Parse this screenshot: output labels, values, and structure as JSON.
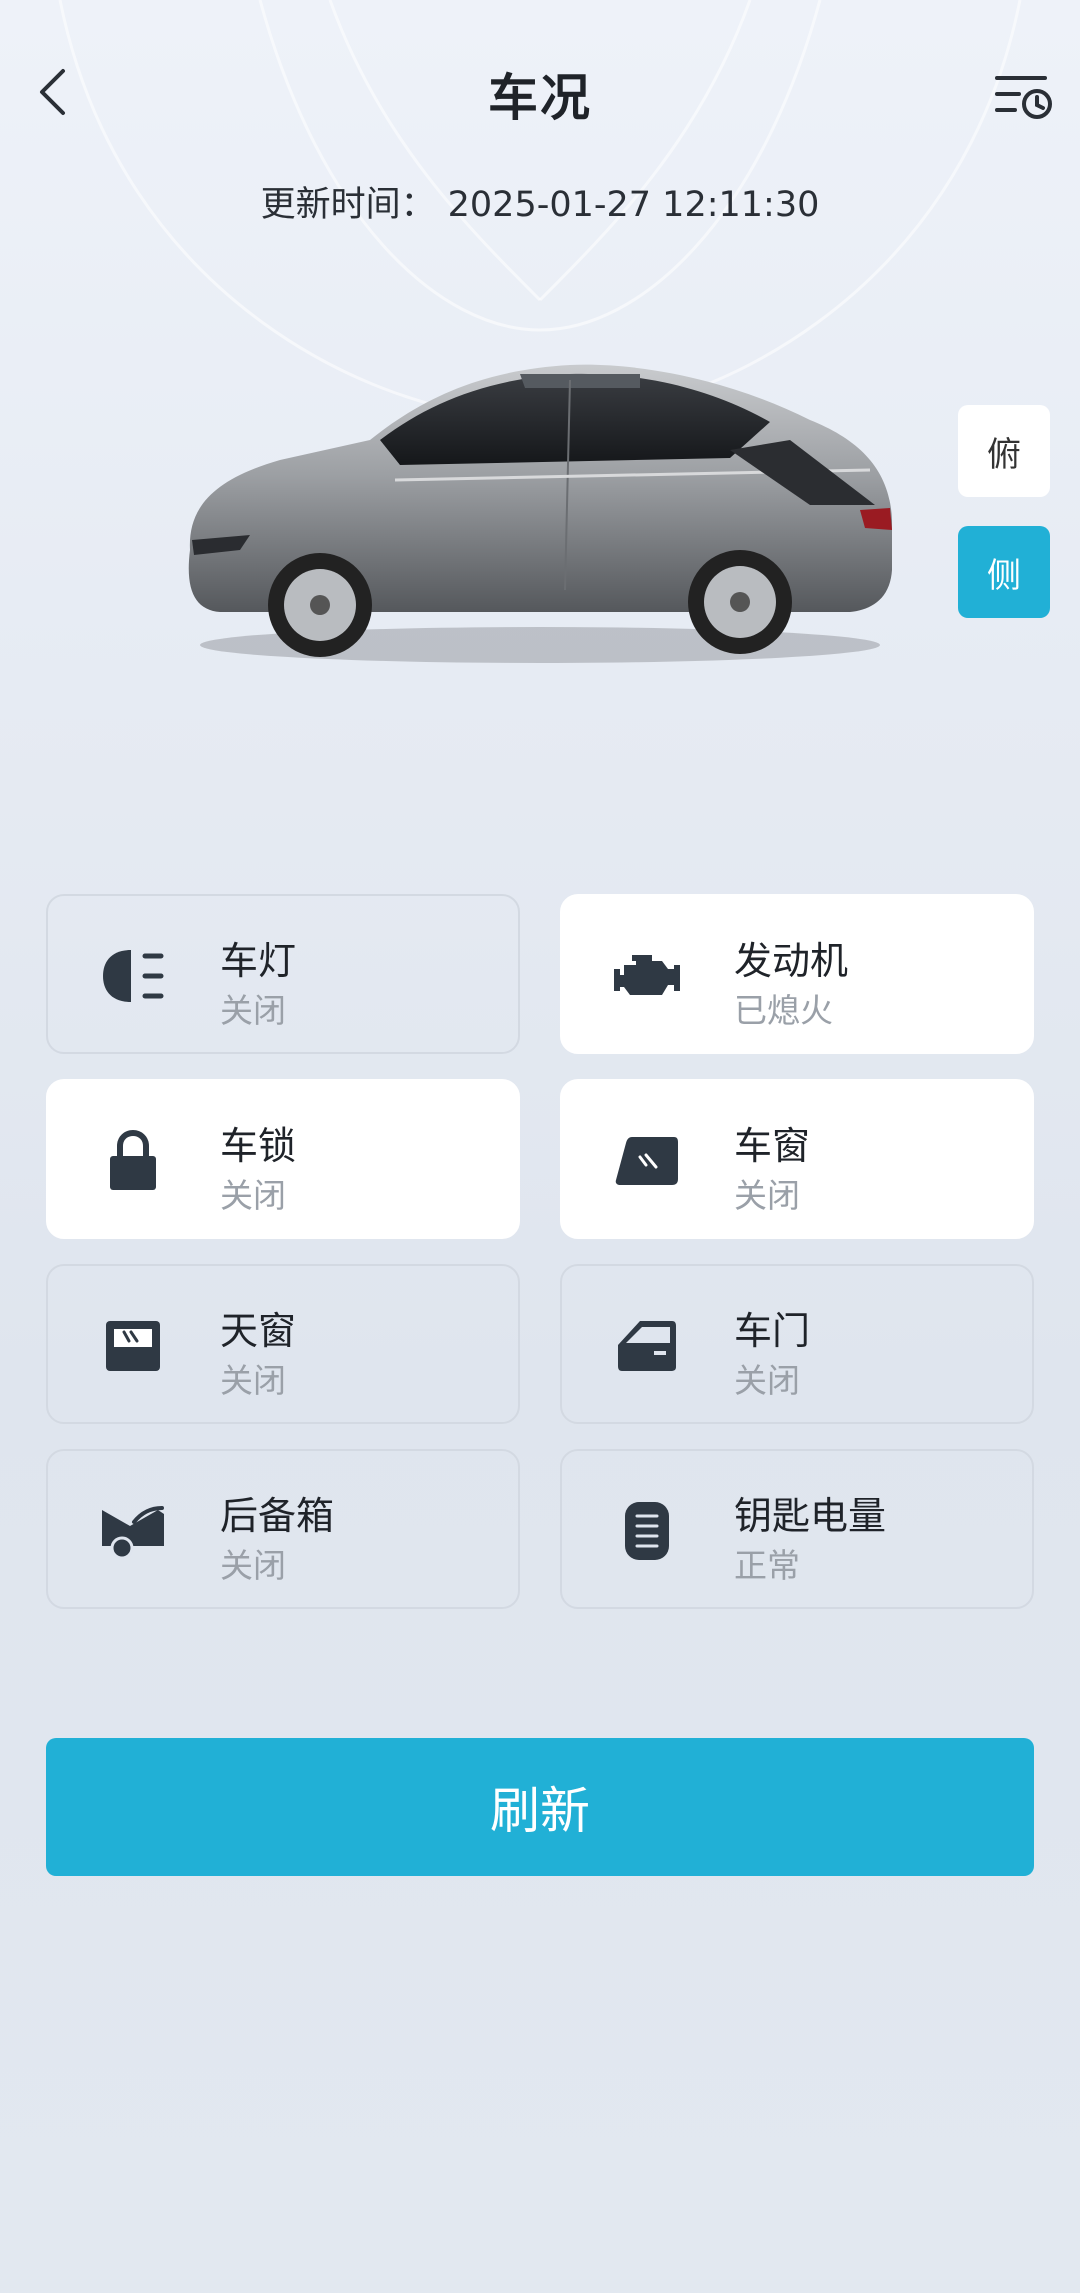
{
  "header": {
    "title": "车况",
    "back_icon": "chevron-left-icon",
    "history_icon": "history-list-icon"
  },
  "update": {
    "label": "更新时间：",
    "value": "2025-01-27 12:11:30"
  },
  "view_toggle": {
    "top_label": "俯",
    "side_label": "侧",
    "active": "side",
    "active_color": "#21b0d6"
  },
  "status_cards": [
    {
      "name": "车灯",
      "state": "关闭",
      "icon": "headlight-icon",
      "highlighted": false
    },
    {
      "name": "发动机",
      "state": "已熄火",
      "icon": "engine-icon",
      "highlighted": true
    },
    {
      "name": "车锁",
      "state": "关闭",
      "icon": "lock-icon",
      "highlighted": true
    },
    {
      "name": "车窗",
      "state": "关闭",
      "icon": "window-icon",
      "highlighted": true
    },
    {
      "name": "天窗",
      "state": "关闭",
      "icon": "sunroof-icon",
      "highlighted": false
    },
    {
      "name": "车门",
      "state": "关闭",
      "icon": "door-icon",
      "highlighted": false
    },
    {
      "name": "后备箱",
      "state": "关闭",
      "icon": "trunk-icon",
      "highlighted": false
    },
    {
      "name": "钥匙电量",
      "state": "正常",
      "icon": "key-battery-icon",
      "highlighted": false
    }
  ],
  "refresh_label": "刷新"
}
